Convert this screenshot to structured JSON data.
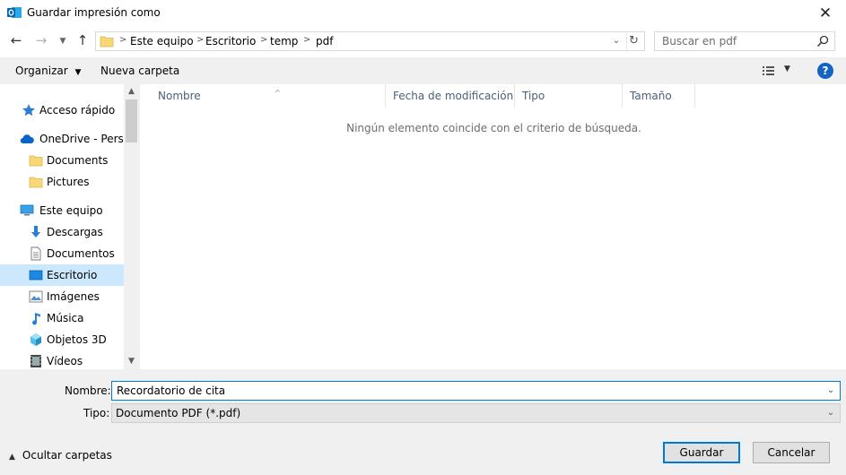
{
  "window": {
    "title": "Guardar impresión como"
  },
  "address": {
    "crumbs": [
      "Este equipo",
      "Escritorio",
      "temp",
      "pdf"
    ]
  },
  "search": {
    "placeholder": "Buscar en pdf"
  },
  "toolbar": {
    "organize_label": "Organizar",
    "new_folder_label": "Nueva carpeta"
  },
  "sidebar": {
    "items": [
      {
        "label": "Acceso rápido",
        "icon": "star-icon"
      },
      {
        "label": "OneDrive - Personal",
        "icon": "cloud-icon"
      },
      {
        "label": "Documents",
        "icon": "folder-icon"
      },
      {
        "label": "Pictures",
        "icon": "folder-icon"
      },
      {
        "label": "Este equipo",
        "icon": "computer-icon"
      },
      {
        "label": "Descargas",
        "icon": "download-icon"
      },
      {
        "label": "Documentos",
        "icon": "document-icon"
      },
      {
        "label": "Escritorio",
        "icon": "desktop-icon",
        "selected": true
      },
      {
        "label": "Imágenes",
        "icon": "image-icon"
      },
      {
        "label": "Música",
        "icon": "music-icon"
      },
      {
        "label": "Objetos 3D",
        "icon": "cube-icon"
      },
      {
        "label": "Vídeos",
        "icon": "video-icon"
      }
    ]
  },
  "content": {
    "columns": [
      "Nombre",
      "Fecha de modificación",
      "Tipo",
      "Tamaño"
    ],
    "empty_message": "Ningún elemento coincide con el criterio de búsqueda."
  },
  "form": {
    "name_label": "Nombre:",
    "name_value": "Recordatorio de cita",
    "type_label": "Tipo:",
    "type_value": "Documento PDF (*.pdf)"
  },
  "footer": {
    "hide_folders_label": "Ocultar carpetas",
    "save_label": "Guardar",
    "cancel_label": "Cancelar"
  },
  "colors": {
    "accent": "#0078d7",
    "selected_bg": "#cce8ff",
    "panel_bg": "#f0f0f0"
  }
}
